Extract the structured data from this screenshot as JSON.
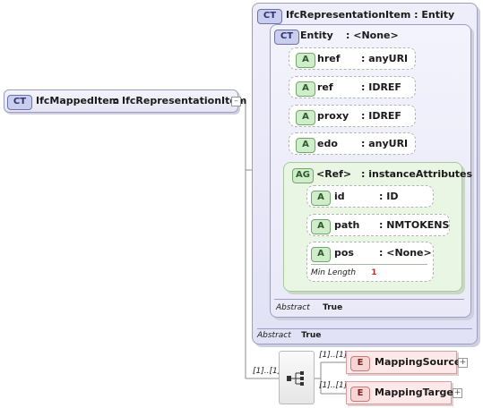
{
  "root": {
    "badge": "CT",
    "name": "IfcMappedItem",
    "sep": ":",
    "type": "IfcRepresentationItem"
  },
  "outer": {
    "badge": "CT",
    "header": "IfcRepresentationItem : Entity",
    "abstract_label": "Abstract",
    "abstract_value": "True"
  },
  "inner": {
    "badge": "CT",
    "name": "Entity",
    "type": ": <None>",
    "abstract_label": "Abstract",
    "abstract_value": "True"
  },
  "attributes": [
    {
      "badge": "A",
      "name": "href",
      "type": ": anyURI"
    },
    {
      "badge": "A",
      "name": "ref",
      "type": ": IDREF"
    },
    {
      "badge": "A",
      "name": "proxy",
      "type": ": IDREF"
    },
    {
      "badge": "A",
      "name": "edo",
      "type": ": anyURI"
    }
  ],
  "group": {
    "badge": "AG",
    "name": "<Ref>",
    "type": ": instanceAttributes",
    "attributes": [
      {
        "badge": "A",
        "name": "id",
        "type": ": ID"
      },
      {
        "badge": "A",
        "name": "path",
        "type": ": NMTOKENS"
      },
      {
        "badge": "A",
        "name": "pos",
        "type": ": <None>",
        "facet_label": "Min Length",
        "facet_value": "1"
      }
    ]
  },
  "sequence": {
    "cardinality": "[1]..[1]"
  },
  "elements": [
    {
      "badge": "E",
      "name": "MappingSource",
      "cardinality": "[1]..[1]"
    },
    {
      "badge": "E",
      "name": "MappingTarget",
      "cardinality": "[1]..[1]"
    }
  ]
}
